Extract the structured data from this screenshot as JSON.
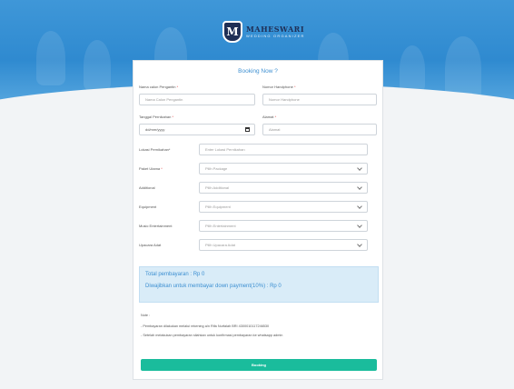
{
  "brand": {
    "name": "MAHESWARI",
    "tagline": "WEDDING ORGANIZER",
    "mark": "M"
  },
  "form": {
    "title": "Booking Now ?",
    "nama": {
      "label": "Nama calon Pengantin",
      "placeholder": "Nama Calon Pengantin"
    },
    "hp": {
      "label": "Nomor Handphone",
      "placeholder": "Nomor Handphone"
    },
    "tanggal": {
      "label": "Tanggal Pernikahan",
      "value": "dd/mm/yyyy"
    },
    "alamat": {
      "label": "Alamat",
      "placeholder": "Alamat"
    },
    "lokasi": {
      "label": "Lokasi Pernikahan*",
      "placeholder": "Enter Lokasi Pernikahan"
    },
    "paket": {
      "label": "Paket Utama",
      "value": "Pilih Package"
    },
    "additional": {
      "label": "Additional",
      "value": "Pilih Additional"
    },
    "equipment": {
      "label": "Equipment",
      "value": "Pilih Equipment"
    },
    "music": {
      "label": "Music Entertainment",
      "value": "Pilih Entertainment"
    },
    "upacara": {
      "label": "Upacara Adat",
      "value": "Pilih Upacara Adat"
    },
    "required_mark": "*"
  },
  "summary": {
    "total": "Total pembayaran : Rp 0",
    "dp": "Diwajibkan untuk membayar down payment(10%) : Rp 0"
  },
  "notes": {
    "heading": "Note :",
    "line1": "- Pembayaran dilakukan melalui rekening a/n Rifa Nurfalah BRI 4300010117246530",
    "line2": "- Setelah melakukan pembayaran silahkan untuk konfirmasi pembayaran ke whatsapp admin"
  },
  "button": {
    "label": "Booking"
  },
  "colors": {
    "accent": "#3d8fd1",
    "button": "#1abc9c",
    "hero": "#2f8ad0",
    "brand_dark": "#1f2f56"
  }
}
